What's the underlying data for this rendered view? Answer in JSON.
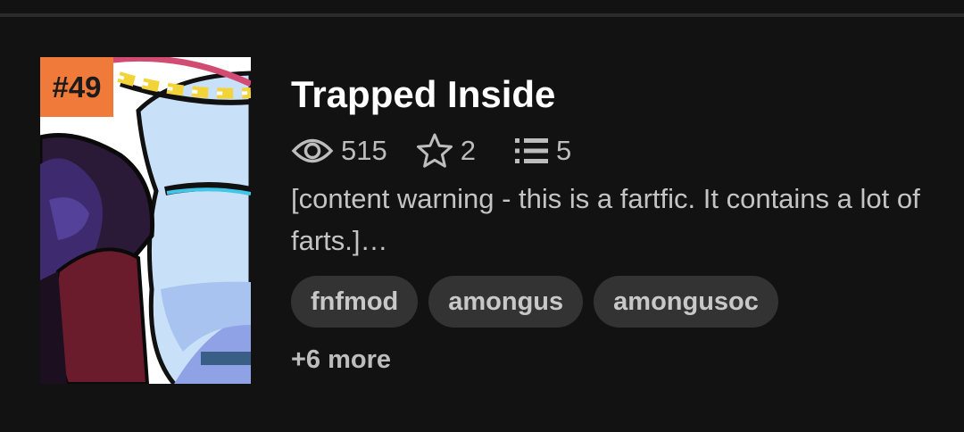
{
  "story": {
    "rank": "#49",
    "title": "Trapped Inside",
    "stats": {
      "views": "515",
      "stars": "2",
      "parts": "5"
    },
    "description": "[content warning - this is a fartfic. It contains a lot of farts.]…",
    "tags": [
      "fnfmod",
      "amongus",
      "amongusoc"
    ],
    "more_tags": "+6 more",
    "cover_icon": "story-cover-image"
  },
  "colors": {
    "background": "#121212",
    "rank_badge": "#f07a3a",
    "tag_background": "#333333",
    "muted_text": "#bdbdbd"
  }
}
